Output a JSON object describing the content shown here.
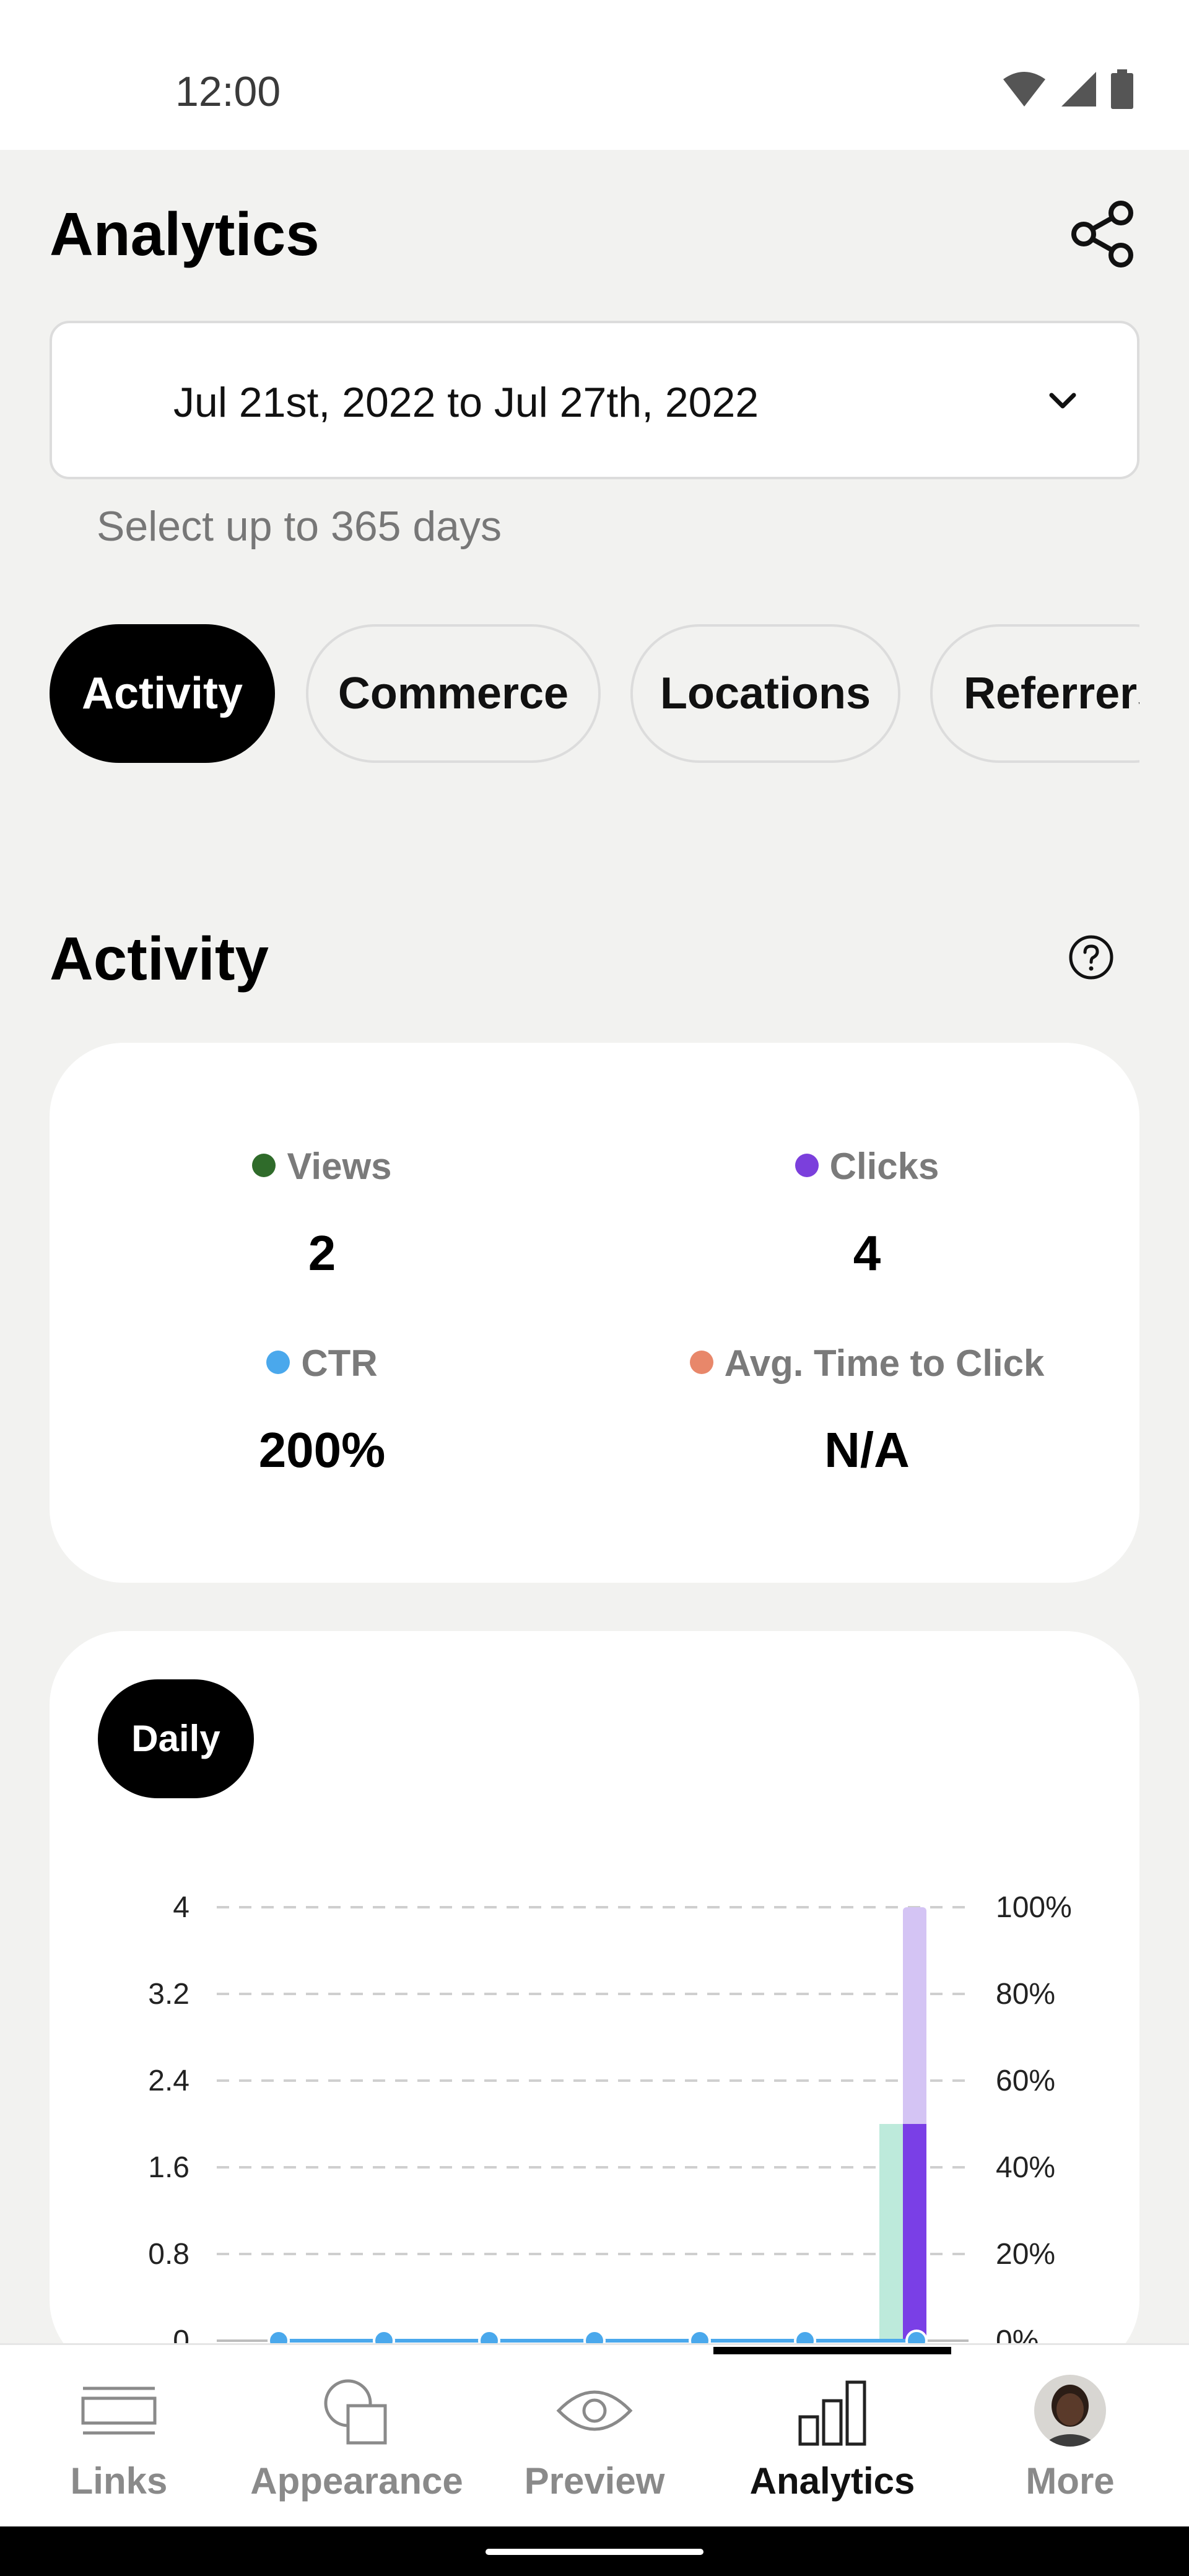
{
  "status_bar": {
    "time": "12:00",
    "icons": [
      "wifi-icon",
      "signal-icon",
      "battery-icon"
    ]
  },
  "header": {
    "title": "Analytics",
    "share_icon": "share-icon"
  },
  "date_range": {
    "value": "Jul 21st, 2022 to Jul 27th, 2022",
    "hint": "Select up to 365 days",
    "chevron_icon": "chevron-down-icon"
  },
  "tabs": [
    {
      "label": "Activity",
      "active": true
    },
    {
      "label": "Commerce",
      "active": false
    },
    {
      "label": "Locations",
      "active": false
    },
    {
      "label": "Referrers",
      "active": false
    }
  ],
  "activity": {
    "title": "Activity",
    "help_icon": "question-circle-icon",
    "metrics": [
      {
        "label": "Views",
        "value": "2",
        "color": "#2f6b2a"
      },
      {
        "label": "Clicks",
        "value": "4",
        "color": "#7b3fdc"
      },
      {
        "label": "CTR",
        "value": "200%",
        "color": "#4aa8ec"
      },
      {
        "label": "Avg. Time to Click",
        "value": "N/A",
        "color": "#e8876a"
      }
    ]
  },
  "chart_card": {
    "period_button": "Daily"
  },
  "chart_data": {
    "type": "bar",
    "ylim": [
      0,
      4
    ],
    "y2lim": [
      0,
      100
    ],
    "y_ticks": [
      "0",
      "0.8",
      "1.6",
      "2.4",
      "3.2",
      "4"
    ],
    "y2_ticks": [
      "0%",
      "20%",
      "40%",
      "60%",
      "80%",
      "100%"
    ],
    "grid": true,
    "series": [
      {
        "values": [
          0,
          0,
          0,
          0,
          0,
          0,
          2
        ],
        "color": "#bdeadb"
      },
      {
        "values": [
          0,
          0,
          0,
          0,
          0,
          0,
          2
        ],
        "color": "#7a3fe6"
      },
      {
        "values": [
          0,
          0,
          0,
          0,
          0,
          0,
          4
        ],
        "color": "#d4c4f4"
      },
      {
        "values": [
          0,
          0,
          0,
          0,
          0,
          0,
          0
        ],
        "color": "#4aa8ec"
      }
    ]
  },
  "bottom_nav": [
    {
      "label": "Links",
      "icon": "links-icon",
      "active": false
    },
    {
      "label": "Appearance",
      "icon": "appearance-icon",
      "active": false
    },
    {
      "label": "Preview",
      "icon": "eye-icon",
      "active": false
    },
    {
      "label": "Analytics",
      "icon": "bar-chart-icon",
      "active": true
    },
    {
      "label": "More",
      "icon": "avatar",
      "active": false
    }
  ]
}
